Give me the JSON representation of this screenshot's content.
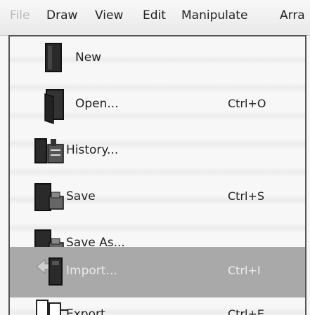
{
  "menubar": {
    "items": [
      "File",
      "Draw",
      "View",
      "Edit",
      "Manipulate",
      "Arra"
    ]
  },
  "menu": {
    "items": [
      {
        "label": "New",
        "shortcut": "",
        "icon": "new-document-icon"
      },
      {
        "label": "Open...",
        "shortcut": "Ctrl+O",
        "icon": "open-document-icon"
      },
      {
        "label": "History...",
        "shortcut": "",
        "icon": "history-icon"
      },
      {
        "label": "Save",
        "shortcut": "Ctrl+S",
        "icon": "save-icon"
      },
      {
        "label": "Save As...",
        "shortcut": "",
        "icon": "save-as-icon"
      },
      {
        "label": "Import...",
        "shortcut": "Ctrl+I",
        "icon": "import-icon"
      },
      {
        "label": "Export...",
        "shortcut": "Ctrl+E",
        "icon": "export-icon"
      }
    ],
    "highlighted_index": 5
  },
  "colors": {
    "highlight": "#a9a9a9",
    "border": "#555555",
    "disabled_text": "#b9b9b9"
  }
}
